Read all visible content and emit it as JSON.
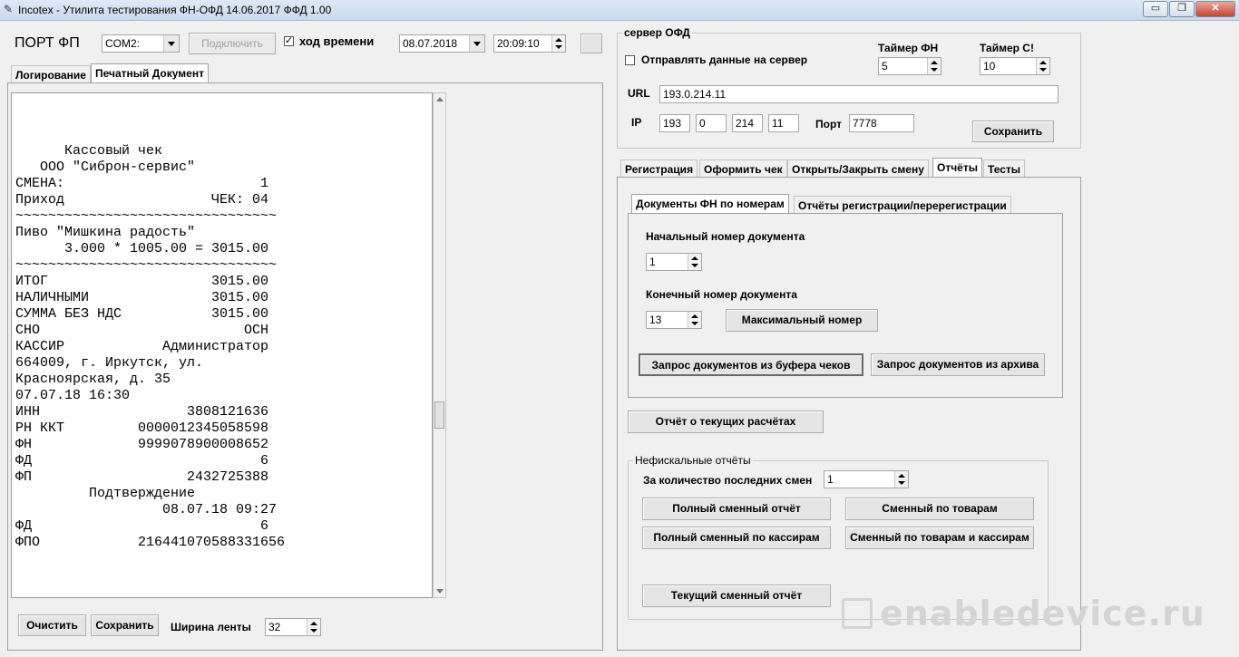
{
  "window": {
    "title": "Incotex - Утилита тестирования ФН-ОФД 14.06.2017   ФФД 1.00",
    "min_glyph": "▭",
    "max_glyph": "❐",
    "close_glyph": "✕"
  },
  "toolbar": {
    "port_label": "ПОРТ ФП",
    "port_value": "COM2:",
    "connect_label": "Подключить",
    "time_check_label": "ход времени",
    "time_checked": "✓",
    "date_value": "08.07.2018",
    "time_value": "20:09:10"
  },
  "left_tabs": [
    {
      "label": "Логирование"
    },
    {
      "label": "Печатный Документ"
    }
  ],
  "receipt_lines": [
    "      Кассовый чек",
    "   ООО \"Сиброн-сервис\"",
    "СМЕНА:                        1",
    "Приход                  ЧЕК: 04",
    "~~~~~~~~~~~~~~~~~~~~~~~~~~~~~~~~",
    "Пиво \"Мишкина радость\"",
    "      3.000 * 1005.00 = 3015.00",
    "~~~~~~~~~~~~~~~~~~~~~~~~~~~~~~~~",
    "ИТОГ                    3015.00",
    "НАЛИЧНЫМИ               3015.00",
    "СУММА БЕЗ НДС           3015.00",
    "СНО                         ОСН",
    "КАССИР            Администратор",
    "664009, г. Иркутск, ул.",
    "Красноярская, д. 35",
    "07.07.18 16:30",
    "ИНН                  3808121636",
    "РН ККТ         0000012345058598",
    "ФН             9999078900008652",
    "ФД                            6",
    "ФП                   2432725388",
    "         Подтверждение",
    "                  08.07.18 09:27",
    "ФД                            6",
    "ФПО            216441070588331656"
  ],
  "bottom": {
    "clear_label": "Очистить",
    "save_label": "Сохранить",
    "width_label": "Ширина ленты",
    "width_value": "32"
  },
  "ofd": {
    "group_label": "сервер ОФД",
    "send_label": "Отправлять данные на сервер",
    "timer_fn_label": "Таймер ФН",
    "timer_fn_value": "5",
    "timer_c_label": "Таймер С!",
    "timer_c_value": "10",
    "url_label": "URL",
    "url_value": "193.0.214.11",
    "ip_label": "IP",
    "ip1": "193",
    "ip2": "0",
    "ip3": "214",
    "ip4": "11",
    "port_label": "Порт",
    "port_value": "7778",
    "save_label": "Сохранить"
  },
  "right_tabs": [
    {
      "label": "Регистрация"
    },
    {
      "label": "Оформить чек"
    },
    {
      "label": "Открыть/Закрыть смену"
    },
    {
      "label": "Отчёты"
    },
    {
      "label": "Тесты"
    }
  ],
  "sub_tabs": [
    {
      "label": "Документы ФН по номерам"
    },
    {
      "label": "Отчёты регистрации/перерегистрации"
    }
  ],
  "docs": {
    "start_label": "Начальный номер документа",
    "start_value": "1",
    "end_label": "Конечный номер документа",
    "end_value": "13",
    "max_label": "Максимальный номер",
    "req_buffer_label": "Запрос документов  из буфера чеков",
    "req_archive_label": "Запрос документов из архива"
  },
  "current_report_label": "Отчёт о текущих расчётах",
  "nonfiscal": {
    "group_label": "Нефискальные отчёты",
    "shifts_label": "За количество последних смен",
    "shifts_value": "1",
    "full_shift": "Полный сменный отчёт",
    "shift_goods": "Сменный по товарам",
    "full_cashiers": "Полный сменный по кассирам",
    "goods_cashiers": "Сменный по товарам и кассирам",
    "current_shift": "Текущий сменный отчёт"
  },
  "watermark": "enabledevice.ru"
}
